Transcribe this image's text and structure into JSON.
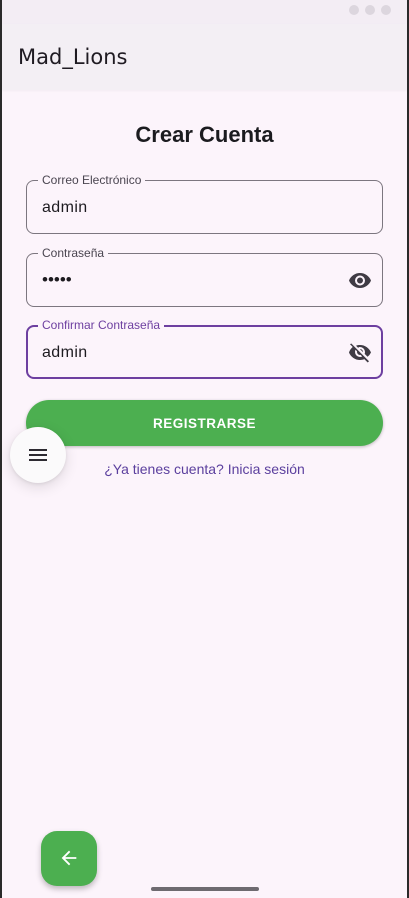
{
  "app": {
    "title": "Mad_Lions"
  },
  "page": {
    "title": "Crear Cuenta"
  },
  "form": {
    "email": {
      "label": "Correo Electrónico",
      "value": "admin"
    },
    "password": {
      "label": "Contraseña",
      "value": "•••••",
      "icon": "eye-icon"
    },
    "confirm_password": {
      "label": "Confirmar Contraseña",
      "value": "admin",
      "icon": "eye-off-icon"
    },
    "register_label": "REGISTRARSE",
    "login_link": "¿Ya tienes cuenta? Inicia sesión"
  },
  "floating": {
    "menu_icon": "menu-icon",
    "back_icon": "arrow-left-icon"
  },
  "colors": {
    "primary": "#4caf50",
    "accent": "#6d3fa0",
    "link": "#5b3f9e",
    "background": "#fcf4fb"
  }
}
